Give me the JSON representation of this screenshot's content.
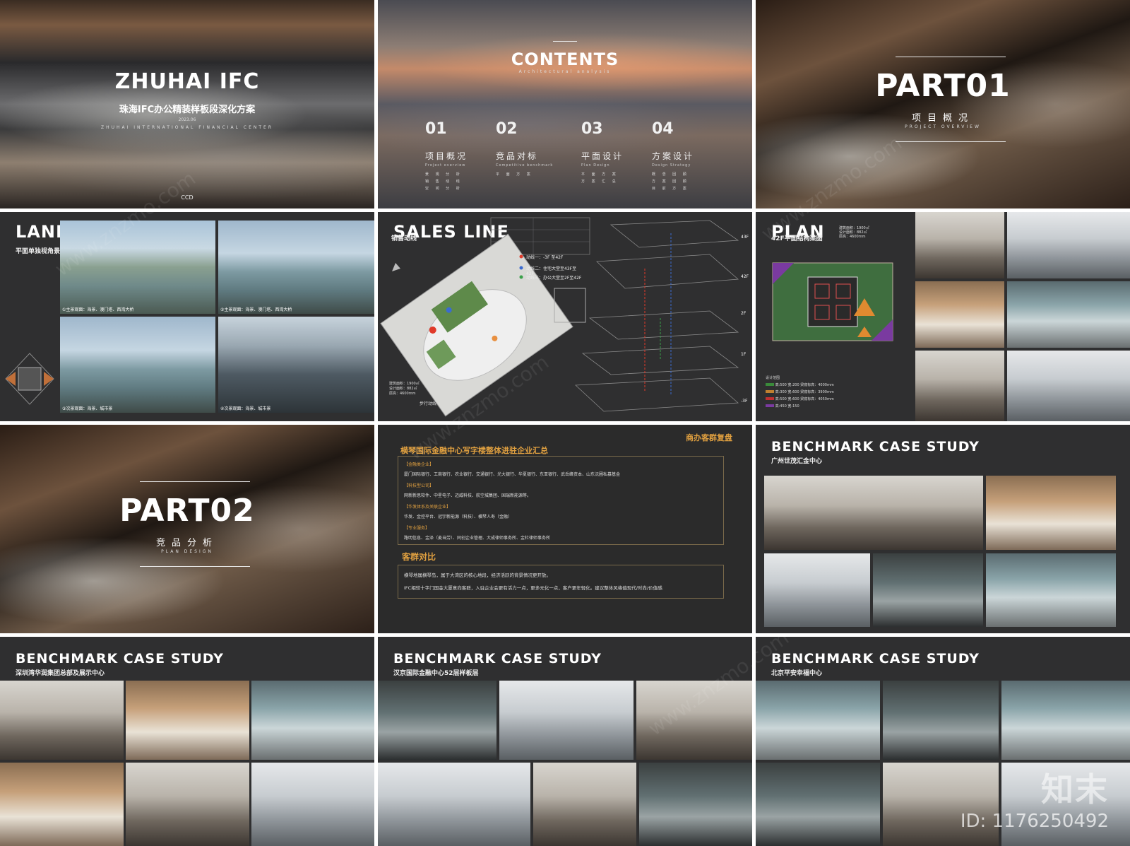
{
  "slide1": {
    "title": "ZHUHAI IFC",
    "subtitle": "珠海IFC办公精装样板段深化方案",
    "date": "2023.06",
    "tagline": "ZHUHAI INTERNATIONAL FINANCIAL CENTER",
    "logo": "CCD"
  },
  "slide2": {
    "title": "CONTENTS",
    "tagline": "Architectural analysis",
    "items": [
      {
        "num": "01",
        "label": "项目概况",
        "en": "Project overview",
        "subs": "景 观 分 析\n销 售 动 线\n空 间 分 析"
      },
      {
        "num": "02",
        "label": "竞品对标",
        "en": "Competitive benchmark",
        "subs": "平 面 方 案"
      },
      {
        "num": "03",
        "label": "平面设计",
        "en": "Plan Design",
        "subs": "平 面 方 案\n方 案 汇 总"
      },
      {
        "num": "04",
        "label": "方案设计",
        "en": "Design Strategy",
        "subs": "概 念 回 顾\n方 案 回 顾\n目 前 方 案"
      }
    ]
  },
  "slide3": {
    "title": "PART01",
    "subtitle": "项目概况",
    "tagline": "PROJECT OVERVIEW"
  },
  "slide4": {
    "title": "LANDSCAPE",
    "subtitle": "平面单独视角景观分析",
    "captions": [
      "①主景观面：海景、澳门塔、西湾大桥",
      "②主景观面：海景、澳门塔、西湾大桥",
      "③次景观面：海景、城市景",
      "④次景观面：海景、城市景"
    ]
  },
  "slide5": {
    "title": "SALES LINE",
    "subtitle": "销售动线",
    "legend": [
      "动线一：-3F 至42F",
      "动线二：住宅大堂至43F至42F",
      "动线三：办公大堂至2F至42F"
    ],
    "floors": [
      "43F",
      "42F",
      "2F",
      "1F",
      "-3F"
    ],
    "stats": [
      "建筑面积：1900㎡",
      "设计面积：882㎡",
      "层高：4600mm"
    ],
    "walk": "步行动线"
  },
  "slide6": {
    "title": "PLAN",
    "subtitle": "42F平面结构梁图",
    "stats": [
      "建筑面积：1900㎡",
      "设计面积：882㎡",
      "层高：4600mm"
    ],
    "legend_title": "设计范围",
    "legend": [
      "高:500  宽:200  梁底标高：4000mm",
      "高:300  宽:600  梁底标高：3900mm",
      "高:500  宽:600  梁底标高：4050mm",
      "高:450  宽:150"
    ]
  },
  "slide7": {
    "title": "PART02",
    "subtitle": "竞品分析",
    "tagline": "PLAN DESIGN"
  },
  "slide8": {
    "corner": "商办客群复盘",
    "heading": "横琴国际金融中心写字楼整体进驻企业汇总",
    "groups": [
      {
        "label": "【金融类企业】",
        "text": "厦门国际银行、工商银行、农业银行、交通银行、光大银行、华夏银行、东亚银行、武岳峰资本、山东沅圃私募基金"
      },
      {
        "label": "【科技型公司】",
        "text": "网新新思软件、中星电子、迈威科技、航空城集团、国瑞新能源等。"
      },
      {
        "label": "【华发体系及关联企业】",
        "text": "华发、金控平台、冠宇新能源（科技）、横琴人寿（金融）"
      },
      {
        "label": "【专业服务】",
        "text": "路明信息、金泽（麦当劳）、同创企业管理、大成律师事务所、金杜律师事务所"
      }
    ],
    "compare_title": "客群对比",
    "compare": [
      "横琴地属横琴岛，属于大湾区的核心地段，经济活跃的背景情况更开放。",
      "IFC相较十字门国金大厦意向客群，入驻企业会更有活力一点，更多元化一点，客户更年轻化。建议整体风格偏现代/时尚/价值感."
    ]
  },
  "slide9": {
    "title": "BENCHMARK CASE STUDY",
    "subtitle": "广州世茂汇金中心"
  },
  "slide10": {
    "title": "BENCHMARK CASE STUDY",
    "subtitle": "深圳湾华润集团总部及展示中心"
  },
  "slide11": {
    "title": "BENCHMARK CASE STUDY",
    "subtitle": "汉京国际金融中心52层样板层"
  },
  "slide12": {
    "title": "BENCHMARK CASE STUDY",
    "subtitle": "北京平安幸福中心"
  },
  "watermark": {
    "logo": "知末",
    "id": "ID: 1176250492",
    "diag": "www.znzmo.com"
  }
}
